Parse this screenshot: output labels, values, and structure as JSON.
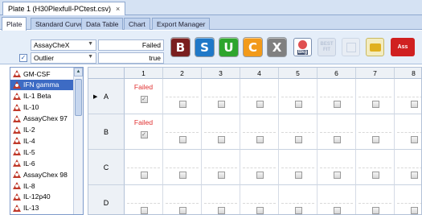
{
  "document_tab": {
    "title": "Plate 1 (H30Plexfull-PCtest.csv)",
    "close_glyph": "×"
  },
  "view_tabs": [
    "Plate",
    "Standard Curve",
    "Data Table",
    "Chart",
    "Export Manager"
  ],
  "active_view_tab": "Plate",
  "toolbar": {
    "selector1": {
      "value": "AssayCheX",
      "result": "Failed"
    },
    "selector2": {
      "value": "Outlier",
      "result": "true",
      "checked": true
    },
    "buttons": [
      {
        "label": "B",
        "color": "#7a1f1f",
        "icon": "letter-b-icon"
      },
      {
        "label": "S",
        "color": "#1f78c8",
        "icon": "letter-s-icon"
      },
      {
        "label": "U",
        "color": "#2ea52e",
        "icon": "letter-u-icon"
      },
      {
        "label": "C",
        "color": "#f29a1a",
        "icon": "letter-c-icon"
      },
      {
        "label": "X",
        "color": "#808080",
        "icon": "letter-x-icon"
      },
      {
        "label": "Bkg",
        "color": "#e05050",
        "icon": "background-icon"
      },
      {
        "label": "BEST FIT",
        "color": "#dfe6f0",
        "icon": "best-fit-icon"
      },
      {
        "label": "",
        "color": "#e8edf4",
        "icon": "blank-tool-icon"
      },
      {
        "label": "",
        "color": "#f0e6a0",
        "icon": "wizard-icon"
      },
      {
        "label": "Ass",
        "color": "#d02020",
        "icon": "assay-icon"
      }
    ]
  },
  "analytes": [
    {
      "name": "GM-CSF",
      "selected": false
    },
    {
      "name": "IFN gamma",
      "selected": true
    },
    {
      "name": "IL-1 Beta",
      "selected": false
    },
    {
      "name": "IL-10",
      "selected": false
    },
    {
      "name": "AssayChex 97",
      "selected": false
    },
    {
      "name": "IL-2",
      "selected": false
    },
    {
      "name": "IL-4",
      "selected": false
    },
    {
      "name": "IL-5",
      "selected": false
    },
    {
      "name": "IL-6",
      "selected": false
    },
    {
      "name": "AssayChex 98",
      "selected": false
    },
    {
      "name": "IL-8",
      "selected": false
    },
    {
      "name": "IL-12p40",
      "selected": false
    },
    {
      "name": "IL-13",
      "selected": false
    }
  ],
  "grid": {
    "columns": [
      "1",
      "2",
      "3",
      "4",
      "5",
      "6",
      "7",
      "8"
    ],
    "rows": [
      {
        "label": "A",
        "current": true,
        "cells": [
          {
            "status": "Failed",
            "checked": true
          },
          {},
          {},
          {},
          {},
          {},
          {},
          {}
        ]
      },
      {
        "label": "B",
        "current": false,
        "cells": [
          {
            "status": "Failed",
            "checked": true
          },
          {},
          {},
          {},
          {},
          {},
          {},
          {}
        ]
      },
      {
        "label": "C",
        "current": false,
        "cells": [
          {},
          {},
          {},
          {},
          {},
          {},
          {},
          {}
        ]
      },
      {
        "label": "D",
        "current": false,
        "cells": [
          {},
          {},
          {},
          {},
          {},
          {},
          {},
          {}
        ]
      }
    ]
  }
}
